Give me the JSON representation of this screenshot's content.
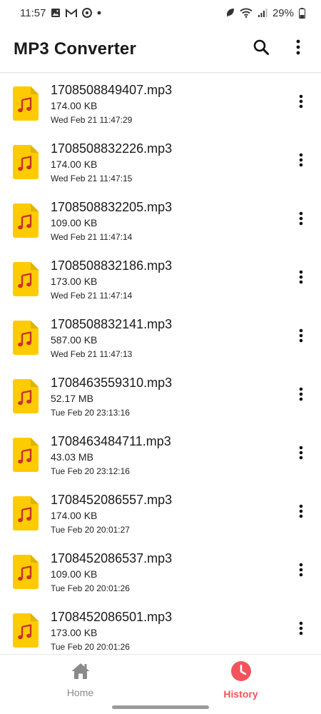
{
  "status_bar": {
    "time": "11:57",
    "battery": "29%",
    "left_icons": [
      "image-icon",
      "gmail-icon",
      "chrome-icon",
      "dot-icon"
    ],
    "right_icons": [
      "leaf-icon",
      "wifi-icon",
      "signal-icon",
      "battery-icon"
    ]
  },
  "app_bar": {
    "title": "MP3 Converter",
    "actions": [
      "search-icon",
      "more-vert-icon"
    ]
  },
  "files": [
    {
      "name": "1708508849407.mp3",
      "size": "174.00 KB",
      "date": "Wed Feb 21 11:47:29"
    },
    {
      "name": "1708508832226.mp3",
      "size": "174.00 KB",
      "date": "Wed Feb 21 11:47:15"
    },
    {
      "name": "1708508832205.mp3",
      "size": "109.00 KB",
      "date": "Wed Feb 21 11:47:14"
    },
    {
      "name": "1708508832186.mp3",
      "size": "173.00 KB",
      "date": "Wed Feb 21 11:47:14"
    },
    {
      "name": "1708508832141.mp3",
      "size": "587.00 KB",
      "date": "Wed Feb 21 11:47:13"
    },
    {
      "name": "1708463559310.mp3",
      "size": "52.17 MB",
      "date": "Tue Feb 20 23:13:16"
    },
    {
      "name": "1708463484711.mp3",
      "size": "43.03 MB",
      "date": "Tue Feb 20 23:12:16"
    },
    {
      "name": "1708452086557.mp3",
      "size": "174.00 KB",
      "date": "Tue Feb 20 20:01:27"
    },
    {
      "name": "1708452086537.mp3",
      "size": "109.00 KB",
      "date": "Tue Feb 20 20:01:26"
    },
    {
      "name": "1708452086501.mp3",
      "size": "173.00 KB",
      "date": "Tue Feb 20 20:01:26"
    }
  ],
  "bottom_nav": {
    "items": [
      {
        "label": "Home",
        "icon": "home-icon",
        "active": false
      },
      {
        "label": "History",
        "icon": "history-clock-icon",
        "active": true
      }
    ]
  },
  "colors": {
    "accent": "#f2545b",
    "file_icon": "#fdcb00",
    "music_note": "#c9302c",
    "inactive": "#8a8a8a"
  }
}
